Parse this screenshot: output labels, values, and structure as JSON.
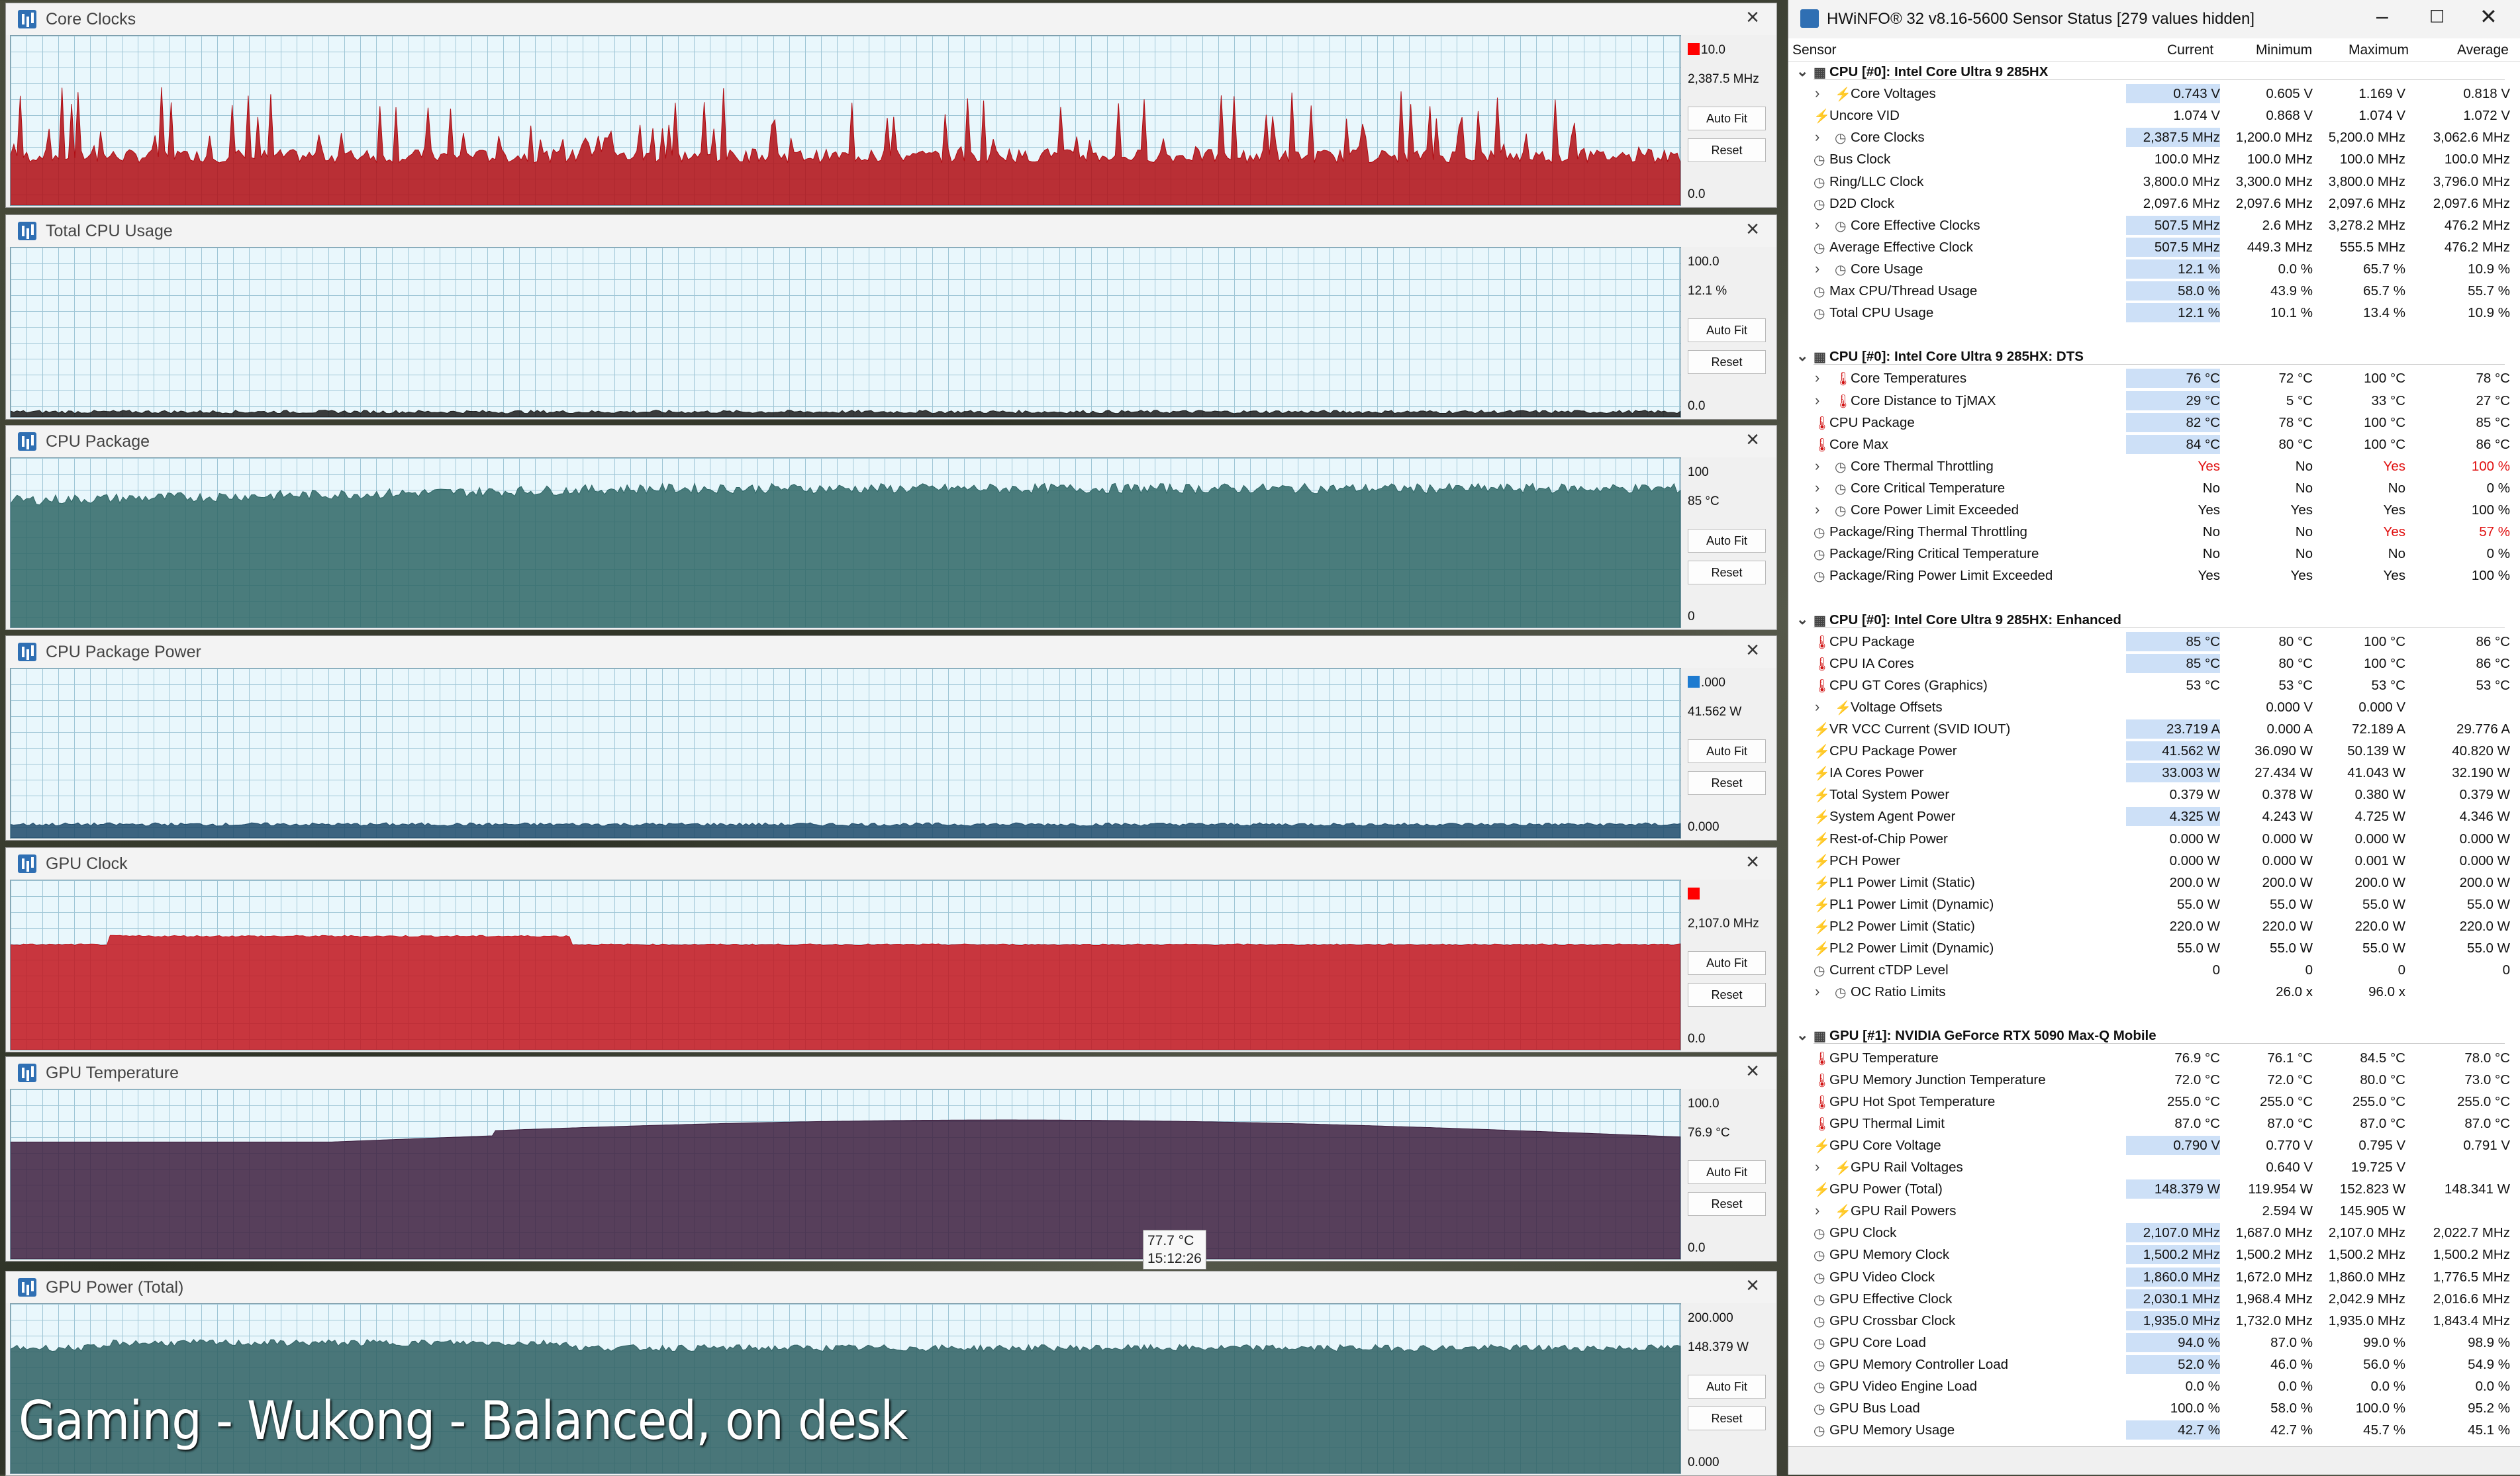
{
  "graph_windows": [
    {
      "title": "Core Clocks",
      "max": "10.0",
      "current": "2,387.5 MHz",
      "min": "0.0",
      "color": "#b00c12",
      "swatch": "#ff0000",
      "level": 0.25,
      "spiky": true
    },
    {
      "title": "Total CPU Usage",
      "max": "100.0",
      "current": "12.1 %",
      "min": "0.0",
      "color": "#1a1a1a",
      "swatch": "",
      "level": 0.03,
      "spiky": false
    },
    {
      "title": "CPU Package",
      "max": "100",
      "current": "85 °C",
      "min": "0",
      "color": "#2e6665",
      "swatch": "",
      "level": 0.82,
      "spiky": false
    },
    {
      "title": "CPU Package Power",
      "max": ".000",
      "current": "41.562 W",
      "min": "0.000",
      "color": "#1d4a6a",
      "swatch": "#1e7bd0",
      "level": 0.08,
      "spiky": false
    },
    {
      "title": "GPU Clock",
      "max": "",
      "current": "2,107.0 MHz",
      "min": "0.0",
      "color": "#c2141c",
      "swatch": "#ff0000",
      "level": 0.62,
      "spiky": false
    },
    {
      "title": "GPU Temperature",
      "max": "100.0",
      "current": "76.9 °C",
      "min": "0.0",
      "color": "#3d1e3e",
      "swatch": "",
      "level": 0.77,
      "spiky": false
    },
    {
      "title": "GPU Power (Total)",
      "max": "200.000",
      "current": "148.379 W",
      "min": "0.000",
      "color": "#2d5f62",
      "swatch": "",
      "level": 0.74,
      "spiky": false
    }
  ],
  "buttons": {
    "auto_fit": "Auto Fit",
    "reset": "Reset"
  },
  "tooltip": {
    "value": "77.7 °C",
    "time": "15:12:26"
  },
  "caption": "Gaming - Wukong - Balanced, on desk",
  "hwinfo": {
    "title": "HWiNFO® 32 v8.16-5600 Sensor Status [279 values hidden]",
    "columns": [
      "Sensor",
      "Current",
      "Minimum",
      "Maximum",
      "Average"
    ],
    "rows": [
      {
        "type": "group",
        "name": "CPU [#0]: Intel Core Ultra 9 285HX"
      },
      {
        "name": "Core Voltages",
        "icon": "bolt",
        "exp": true,
        "cur": "0.743 V",
        "min": "0.605 V",
        "max": "1.169 V",
        "avg": "0.818 V",
        "hl": true
      },
      {
        "name": "Uncore VID",
        "icon": "bolt",
        "cur": "1.074 V",
        "min": "0.868 V",
        "max": "1.074 V",
        "avg": "1.072 V"
      },
      {
        "name": "Core Clocks",
        "icon": "clock",
        "exp": true,
        "cur": "2,387.5 MHz",
        "min": "1,200.0 MHz",
        "max": "5,200.0 MHz",
        "avg": "3,062.6 MHz",
        "hl": true
      },
      {
        "name": "Bus Clock",
        "icon": "clock",
        "cur": "100.0 MHz",
        "min": "100.0 MHz",
        "max": "100.0 MHz",
        "avg": "100.0 MHz"
      },
      {
        "name": "Ring/LLC Clock",
        "icon": "clock",
        "cur": "3,800.0 MHz",
        "min": "3,300.0 MHz",
        "max": "3,800.0 MHz",
        "avg": "3,796.0 MHz"
      },
      {
        "name": "D2D Clock",
        "icon": "clock",
        "cur": "2,097.6 MHz",
        "min": "2,097.6 MHz",
        "max": "2,097.6 MHz",
        "avg": "2,097.6 MHz"
      },
      {
        "name": "Core Effective Clocks",
        "icon": "clock",
        "exp": true,
        "cur": "507.5 MHz",
        "min": "2.6 MHz",
        "max": "3,278.2 MHz",
        "avg": "476.2 MHz",
        "hl": true
      },
      {
        "name": "Average Effective Clock",
        "icon": "clock",
        "cur": "507.5 MHz",
        "min": "449.3 MHz",
        "max": "555.5 MHz",
        "avg": "476.2 MHz",
        "hl": true
      },
      {
        "name": "Core Usage",
        "icon": "clock",
        "exp": true,
        "cur": "12.1 %",
        "min": "0.0 %",
        "max": "65.7 %",
        "avg": "10.9 %",
        "hl": true
      },
      {
        "name": "Max CPU/Thread Usage",
        "icon": "clock",
        "cur": "58.0 %",
        "min": "43.9 %",
        "max": "65.7 %",
        "avg": "55.7 %",
        "hl": true
      },
      {
        "name": "Total CPU Usage",
        "icon": "clock",
        "cur": "12.1 %",
        "min": "10.1 %",
        "max": "13.4 %",
        "avg": "10.9 %",
        "hl": true
      },
      {
        "type": "gap"
      },
      {
        "type": "group",
        "name": "CPU [#0]: Intel Core Ultra 9 285HX: DTS"
      },
      {
        "name": "Core Temperatures",
        "icon": "therm",
        "exp": true,
        "cur": "76 °C",
        "min": "72 °C",
        "max": "100 °C",
        "avg": "78 °C",
        "hl": true
      },
      {
        "name": "Core Distance to TjMAX",
        "icon": "therm",
        "exp": true,
        "cur": "29 °C",
        "min": "5 °C",
        "max": "33 °C",
        "avg": "27 °C",
        "hl": true
      },
      {
        "name": "CPU Package",
        "icon": "therm",
        "cur": "82 °C",
        "min": "78 °C",
        "max": "100 °C",
        "avg": "85 °C",
        "hl": true
      },
      {
        "name": "Core Max",
        "icon": "therm",
        "cur": "84 °C",
        "min": "80 °C",
        "max": "100 °C",
        "avg": "86 °C",
        "hl": true
      },
      {
        "name": "Core Thermal Throttling",
        "icon": "clock",
        "exp": true,
        "cur": "Yes",
        "min": "No",
        "max": "Yes",
        "avg": "100 %",
        "red_cur": true,
        "red_max": true,
        "red_avg": true
      },
      {
        "name": "Core Critical Temperature",
        "icon": "clock",
        "exp": true,
        "cur": "No",
        "min": "No",
        "max": "No",
        "avg": "0 %"
      },
      {
        "name": "Core Power Limit Exceeded",
        "icon": "clock",
        "exp": true,
        "cur": "Yes",
        "min": "Yes",
        "max": "Yes",
        "avg": "100 %"
      },
      {
        "name": "Package/Ring Thermal Throttling",
        "icon": "clock",
        "cur": "No",
        "min": "No",
        "max": "Yes",
        "avg": "57 %",
        "red_max": true,
        "red_avg": true
      },
      {
        "name": "Package/Ring Critical Temperature",
        "icon": "clock",
        "cur": "No",
        "min": "No",
        "max": "No",
        "avg": "0 %"
      },
      {
        "name": "Package/Ring Power Limit Exceeded",
        "icon": "clock",
        "cur": "Yes",
        "min": "Yes",
        "max": "Yes",
        "avg": "100 %"
      },
      {
        "type": "gap"
      },
      {
        "type": "group",
        "name": "CPU [#0]: Intel Core Ultra 9 285HX: Enhanced"
      },
      {
        "name": "CPU Package",
        "icon": "therm",
        "cur": "85 °C",
        "min": "80 °C",
        "max": "100 °C",
        "avg": "86 °C",
        "hl": true
      },
      {
        "name": "CPU IA Cores",
        "icon": "therm",
        "cur": "85 °C",
        "min": "80 °C",
        "max": "100 °C",
        "avg": "86 °C",
        "hl": true
      },
      {
        "name": "CPU GT Cores (Graphics)",
        "icon": "therm",
        "cur": "53 °C",
        "min": "53 °C",
        "max": "53 °C",
        "avg": "53 °C"
      },
      {
        "name": "Voltage Offsets",
        "icon": "bolt",
        "exp": true,
        "cur": "",
        "min": "0.000 V",
        "max": "0.000 V",
        "avg": ""
      },
      {
        "name": "VR VCC Current (SVID IOUT)",
        "icon": "bolt",
        "cur": "23.719 A",
        "min": "0.000 A",
        "max": "72.189 A",
        "avg": "29.776 A",
        "hl": true
      },
      {
        "name": "CPU Package Power",
        "icon": "bolt",
        "cur": "41.562 W",
        "min": "36.090 W",
        "max": "50.139 W",
        "avg": "40.820 W",
        "hl": true
      },
      {
        "name": "IA Cores Power",
        "icon": "bolt",
        "cur": "33.003 W",
        "min": "27.434 W",
        "max": "41.043 W",
        "avg": "32.190 W",
        "hl": true
      },
      {
        "name": "Total System Power",
        "icon": "bolt",
        "cur": "0.379 W",
        "min": "0.378 W",
        "max": "0.380 W",
        "avg": "0.379 W"
      },
      {
        "name": "System Agent Power",
        "icon": "bolt",
        "cur": "4.325 W",
        "min": "4.243 W",
        "max": "4.725 W",
        "avg": "4.346 W",
        "hl": true
      },
      {
        "name": "Rest-of-Chip Power",
        "icon": "bolt",
        "cur": "0.000 W",
        "min": "0.000 W",
        "max": "0.000 W",
        "avg": "0.000 W"
      },
      {
        "name": "PCH Power",
        "icon": "bolt",
        "cur": "0.000 W",
        "min": "0.000 W",
        "max": "0.001 W",
        "avg": "0.000 W"
      },
      {
        "name": "PL1 Power Limit (Static)",
        "icon": "bolt",
        "cur": "200.0 W",
        "min": "200.0 W",
        "max": "200.0 W",
        "avg": "200.0 W"
      },
      {
        "name": "PL1 Power Limit (Dynamic)",
        "icon": "bolt",
        "cur": "55.0 W",
        "min": "55.0 W",
        "max": "55.0 W",
        "avg": "55.0 W"
      },
      {
        "name": "PL2 Power Limit (Static)",
        "icon": "bolt",
        "cur": "220.0 W",
        "min": "220.0 W",
        "max": "220.0 W",
        "avg": "220.0 W"
      },
      {
        "name": "PL2 Power Limit (Dynamic)",
        "icon": "bolt",
        "cur": "55.0 W",
        "min": "55.0 W",
        "max": "55.0 W",
        "avg": "55.0 W"
      },
      {
        "name": "Current cTDP Level",
        "icon": "clock",
        "cur": "0",
        "min": "0",
        "max": "0",
        "avg": "0"
      },
      {
        "name": "OC Ratio Limits",
        "icon": "clock",
        "exp": true,
        "cur": "",
        "min": "26.0 x",
        "max": "96.0 x",
        "avg": ""
      },
      {
        "type": "gap"
      },
      {
        "type": "group",
        "name": "GPU [#1]: NVIDIA  GeForce RTX 5090 Max-Q Mobile"
      },
      {
        "name": "GPU Temperature",
        "icon": "therm",
        "cur": "76.9 °C",
        "min": "76.1 °C",
        "max": "84.5 °C",
        "avg": "78.0 °C"
      },
      {
        "name": "GPU Memory Junction Temperature",
        "icon": "therm",
        "cur": "72.0 °C",
        "min": "72.0 °C",
        "max": "80.0 °C",
        "avg": "73.0 °C"
      },
      {
        "name": "GPU Hot Spot Temperature",
        "icon": "therm",
        "cur": "255.0 °C",
        "min": "255.0 °C",
        "max": "255.0 °C",
        "avg": "255.0 °C"
      },
      {
        "name": "GPU Thermal Limit",
        "icon": "therm",
        "cur": "87.0 °C",
        "min": "87.0 °C",
        "max": "87.0 °C",
        "avg": "87.0 °C"
      },
      {
        "name": "GPU Core Voltage",
        "icon": "bolt",
        "cur": "0.790 V",
        "min": "0.770 V",
        "max": "0.795 V",
        "avg": "0.791 V",
        "hl": true
      },
      {
        "name": "GPU Rail Voltages",
        "icon": "bolt",
        "exp": true,
        "cur": "",
        "min": "0.640 V",
        "max": "19.725 V",
        "avg": ""
      },
      {
        "name": "GPU Power (Total)",
        "icon": "bolt",
        "cur": "148.379 W",
        "min": "119.954 W",
        "max": "152.823 W",
        "avg": "148.341 W",
        "hl": true
      },
      {
        "name": "GPU Rail Powers",
        "icon": "bolt",
        "exp": true,
        "cur": "",
        "min": "2.594 W",
        "max": "145.905 W",
        "avg": ""
      },
      {
        "name": "GPU Clock",
        "icon": "clock",
        "cur": "2,107.0 MHz",
        "min": "1,687.0 MHz",
        "max": "2,107.0 MHz",
        "avg": "2,022.7 MHz",
        "hl": true
      },
      {
        "name": "GPU Memory Clock",
        "icon": "clock",
        "cur": "1,500.2 MHz",
        "min": "1,500.2 MHz",
        "max": "1,500.2 MHz",
        "avg": "1,500.2 MHz",
        "hl": true
      },
      {
        "name": "GPU Video Clock",
        "icon": "clock",
        "cur": "1,860.0 MHz",
        "min": "1,672.0 MHz",
        "max": "1,860.0 MHz",
        "avg": "1,776.5 MHz",
        "hl": true
      },
      {
        "name": "GPU Effective Clock",
        "icon": "clock",
        "cur": "2,030.1 MHz",
        "min": "1,968.4 MHz",
        "max": "2,042.9 MHz",
        "avg": "2,016.6 MHz",
        "hl": true
      },
      {
        "name": "GPU Crossbar Clock",
        "icon": "clock",
        "cur": "1,935.0 MHz",
        "min": "1,732.0 MHz",
        "max": "1,935.0 MHz",
        "avg": "1,843.4 MHz",
        "hl": true
      },
      {
        "name": "GPU Core Load",
        "icon": "clock",
        "cur": "94.0 %",
        "min": "87.0 %",
        "max": "99.0 %",
        "avg": "98.9 %",
        "hl": true
      },
      {
        "name": "GPU Memory Controller Load",
        "icon": "clock",
        "cur": "52.0 %",
        "min": "46.0 %",
        "max": "56.0 %",
        "avg": "54.9 %",
        "hl": true
      },
      {
        "name": "GPU Video Engine Load",
        "icon": "clock",
        "cur": "0.0 %",
        "min": "0.0 %",
        "max": "0.0 %",
        "avg": "0.0 %"
      },
      {
        "name": "GPU Bus Load",
        "icon": "clock",
        "cur": "100.0 %",
        "min": "58.0 %",
        "max": "100.0 %",
        "avg": "95.2 %"
      },
      {
        "name": "GPU Memory Usage",
        "icon": "clock",
        "cur": "42.7 %",
        "min": "42.7 %",
        "max": "45.7 %",
        "avg": "45.1 %",
        "hl": true
      }
    ]
  }
}
